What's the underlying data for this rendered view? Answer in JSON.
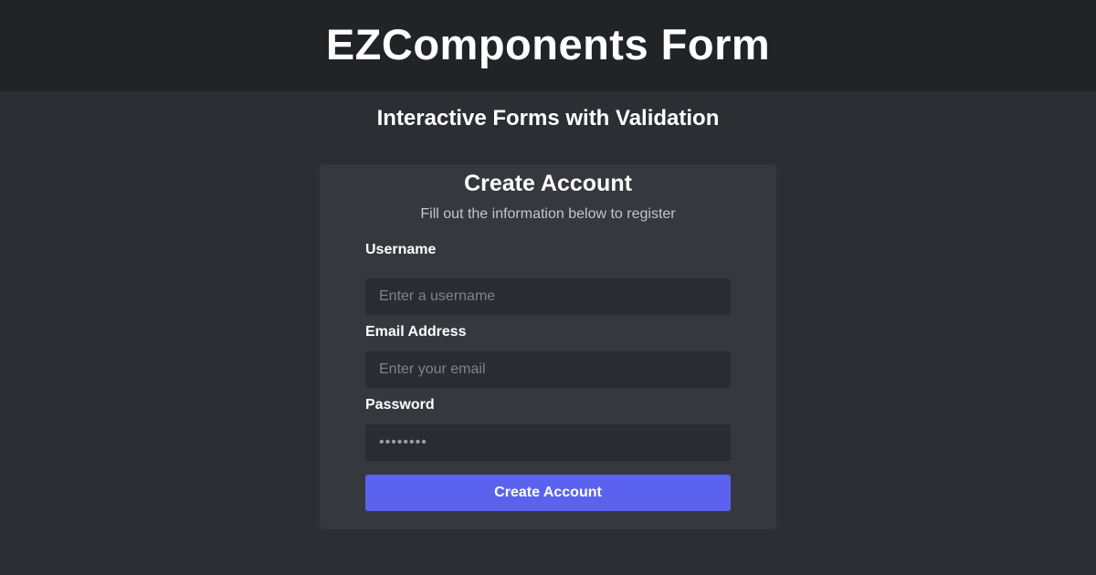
{
  "header": {
    "title": "EZComponents Form"
  },
  "page": {
    "subtitle": "Interactive Forms with Validation"
  },
  "form": {
    "title": "Create Account",
    "description": "Fill out the information below to register",
    "fields": {
      "username": {
        "label": "Username",
        "placeholder": "Enter a username",
        "value": ""
      },
      "email": {
        "label": "Email Address",
        "placeholder": "Enter your email",
        "value": ""
      },
      "password": {
        "label": "Password",
        "placeholder": "••••••••",
        "value": ""
      }
    },
    "submit_label": "Create Account"
  },
  "colors": {
    "background": "#2b2e33",
    "header_background": "#212427",
    "card_background": "#35383e",
    "input_background": "#2a2c31",
    "accent": "#5b63ee"
  }
}
